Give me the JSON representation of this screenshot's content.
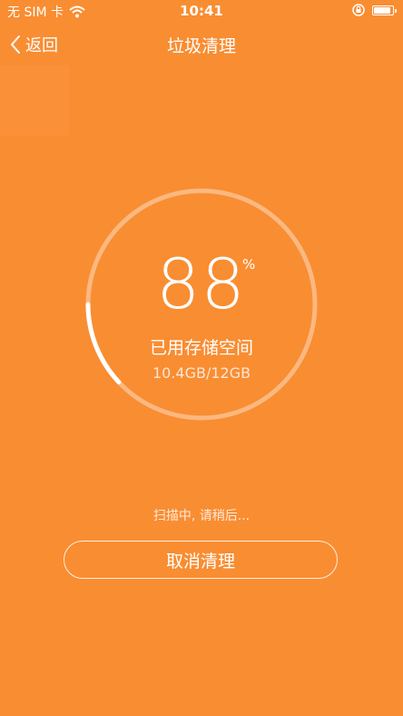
{
  "status_bar": {
    "carrier": "无 SIM 卡",
    "time": "10:41",
    "icons": [
      "wifi-icon",
      "rotation-lock-icon",
      "battery-icon"
    ]
  },
  "nav": {
    "back_label": "返回",
    "title": "垃圾清理"
  },
  "storage": {
    "percent": "88",
    "percent_sign": "%",
    "progress_fraction": 0.12,
    "label": "已用存储空间",
    "size": "10.4GB/12GB"
  },
  "scan_status": "扫描中, 请稍后...",
  "cancel_label": "取消清理",
  "colors": {
    "background": "#F98D32",
    "text": "#FFFFFF"
  }
}
